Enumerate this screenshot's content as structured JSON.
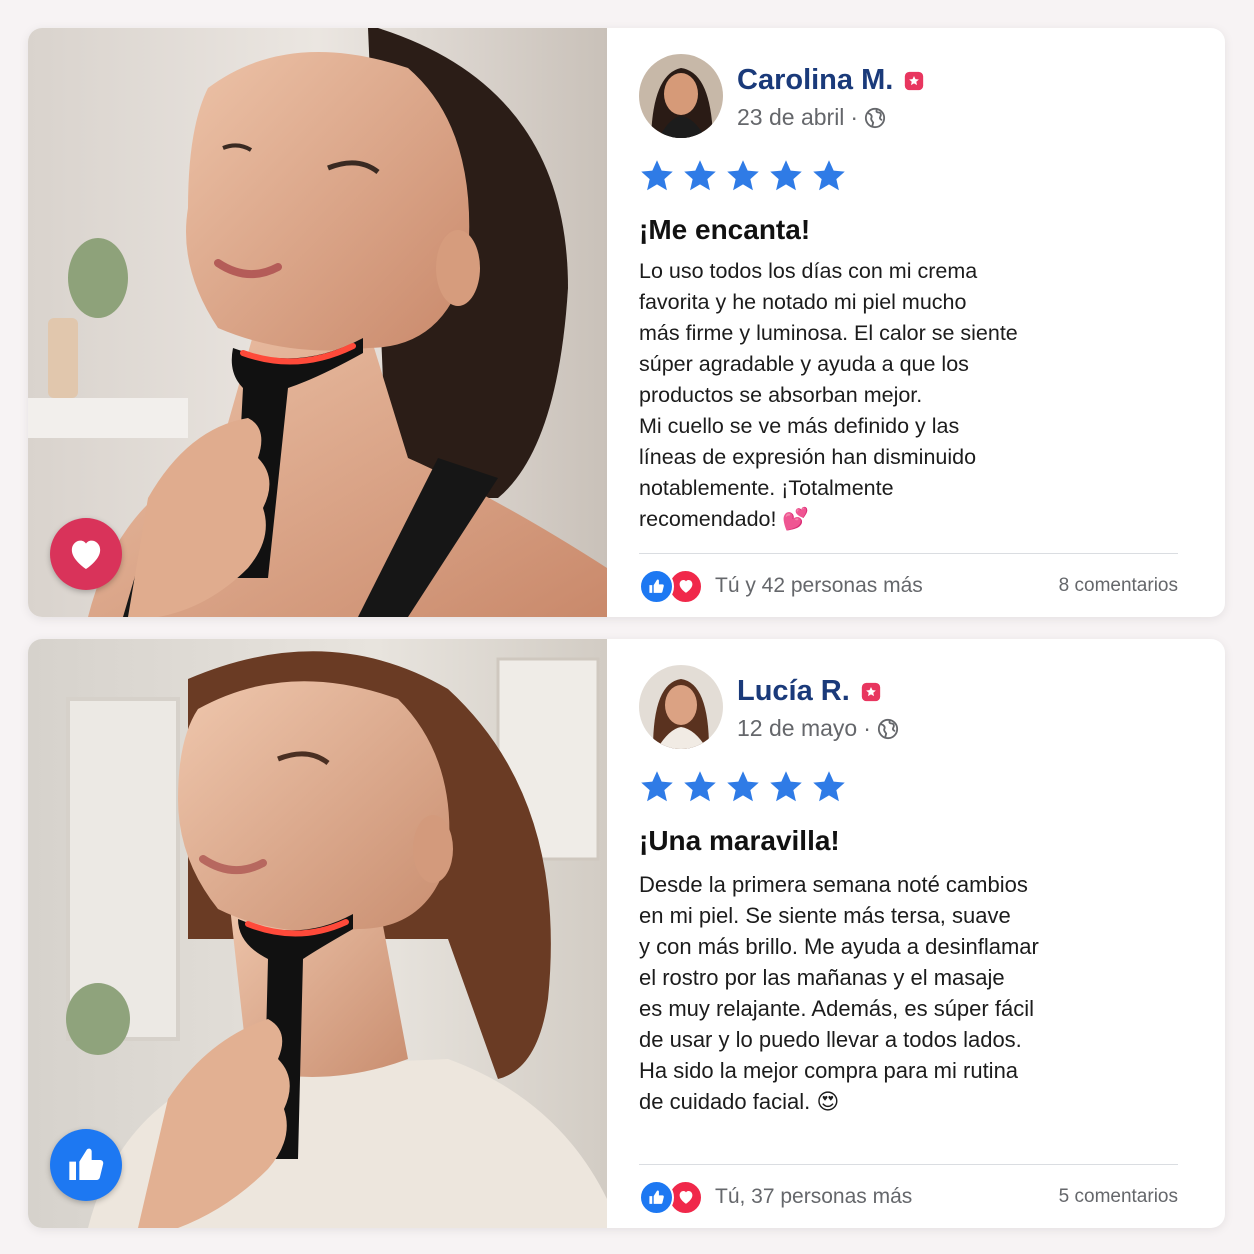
{
  "colors": {
    "name": "#1a3a7a",
    "star": "#2f7be6",
    "like": "#1d78f2",
    "love": "#f0284a",
    "heart_badge": "#d9335a",
    "verified": "#e8365f"
  },
  "reviews": [
    {
      "name": "Carolina M.",
      "date": "23 de abril",
      "separator": "·",
      "rating": 5,
      "title": "¡Me encanta!",
      "body": "Lo uso todos los días con mi crema\nfavorita y he notado mi piel mucho\nmás firme y luminosa. El calor se siente\nsúper agradable y ayuda a que los\nproductos se absorban mejor.\nMi cuello se ve más definido y las\nlíneas de expresión han disminuido\nnotablemente. ¡Totalmente\nrecomendado! 💕",
      "reactions_text": "Tú y 42 personas más",
      "comments_text": "8 comentarios",
      "photo_badge_icon": "heart-icon"
    },
    {
      "name": "Lucía R.",
      "date": "12 de mayo",
      "separator": "·",
      "rating": 5,
      "title": "¡Una maravilla!",
      "body": "Desde la primera semana noté cambios\nen mi piel. Se siente más tersa, suave\ny con más brillo. Me ayuda a desinflamar\nel rostro por las mañanas y el masaje\nes muy relajante. Además, es súper fácil\nde usar y lo puedo llevar a todos lados.\nHa sido la mejor compra para mi rutina\nde cuidado facial. 😍",
      "reactions_text": "Tú, 37 personas más",
      "comments_text": "5 comentarios",
      "photo_badge_icon": "thumbs-up-icon"
    }
  ]
}
